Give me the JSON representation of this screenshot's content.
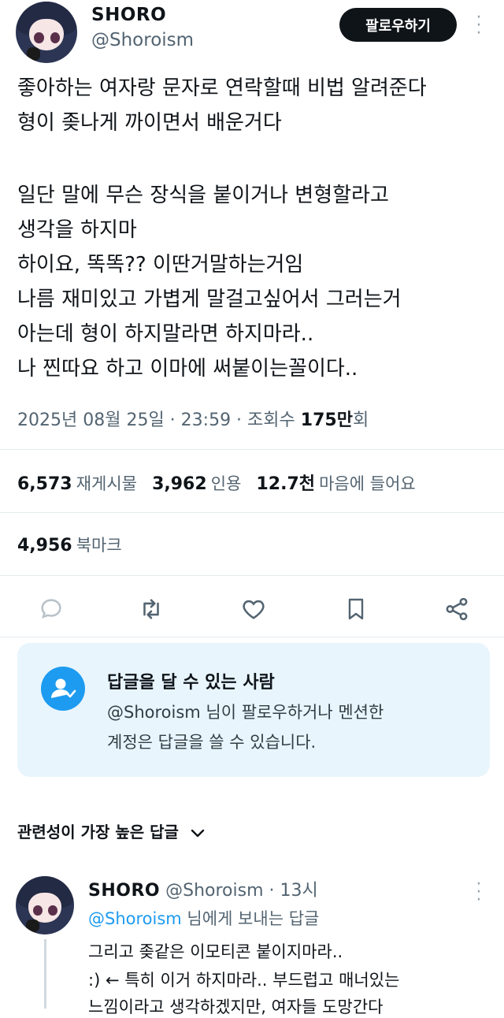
{
  "tweet": {
    "author_name": "SHORO",
    "author_handle": "@Shoroism",
    "follow_label": "팔로우하기",
    "lines": [
      "좋아하는 여자랑 문자로 연락할때 비법 알려준다",
      "형이 좆나게 까이면서 배운거다",
      "",
      "일단 말에 무슨 장식을 붙이거나 변형할라고",
      "생각을 하지마",
      "하이요, 똑똑?? 이딴거말하는거임",
      "나름 재미있고 가볍게 말걸고싶어서 그러는거",
      "아는데 형이 하지말라면 하지마라..",
      "나 찐따요 하고 이마에 써붙이는꼴이다.."
    ],
    "meta_prefix": "2025년 08월 25일 · 23:59 · 조회수 ",
    "views": "175만",
    "views_suffix": "회"
  },
  "stats": {
    "retweets_count": "6,573",
    "retweets_label": "재게시물",
    "quotes_count": "3,962",
    "quotes_label": "인용",
    "likes_count": "12.7천",
    "likes_label": "마음에 들어요",
    "bookmarks_count": "4,956",
    "bookmarks_label": "북마크"
  },
  "actions": [
    "reply-icon",
    "retweet-icon",
    "heart-icon",
    "bookmark-icon",
    "share-icon"
  ],
  "reply_restriction": {
    "title": "답글을 달 수 있는 사람",
    "line1": "@Shoroism 님이 팔로우하거나 멘션한",
    "line2": "계정은 답글을 쓸 수 있습니다."
  },
  "sort": {
    "label": "관련성이 가장 높은 답글"
  },
  "reply": {
    "author_name": "SHORO",
    "author_handle": "@Shoroism",
    "time": "· 13시",
    "replying_handle": "@Shoroism",
    "replying_suffix": " 님에게 보내는 답글",
    "line1": "그리고 좆같은 이모티콘 붙이지마라..",
    "line2": ":) ← 특히 이거 하지마라.. 부드럽고 매너있는",
    "line3": "느낌이라고 생각하겠지만, 여자들 도망간다"
  },
  "colors": {
    "accent": "#1d9bf0",
    "text": "#0f1419",
    "muted": "#536471",
    "reply_box_bg": "#e8f5fd"
  }
}
